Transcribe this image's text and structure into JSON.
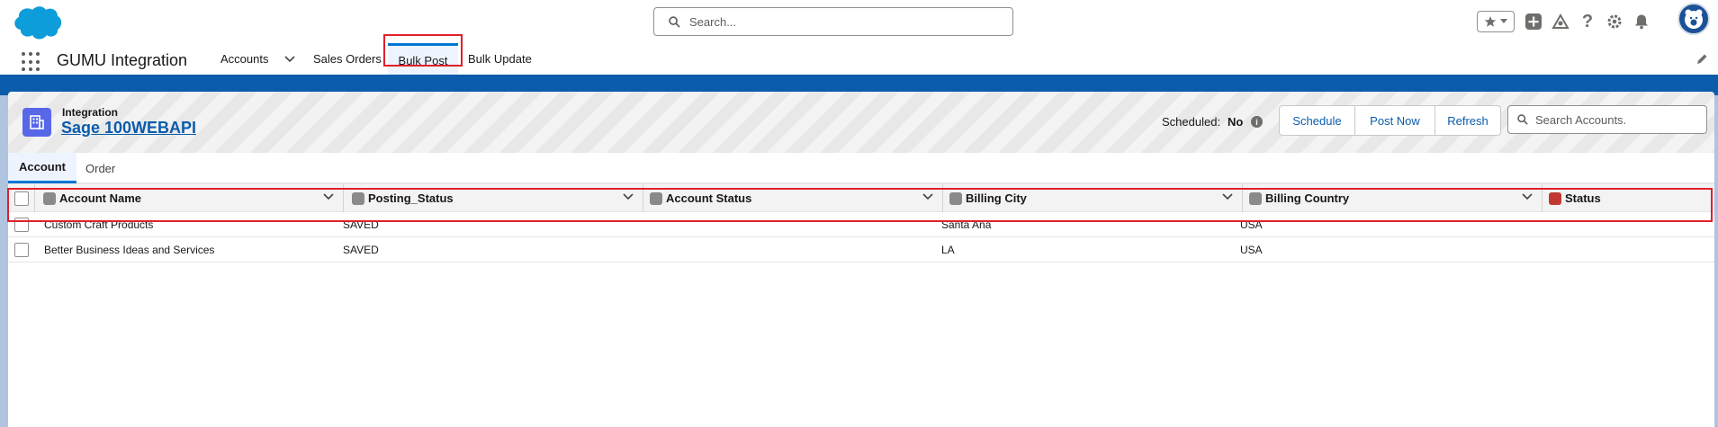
{
  "colors": {
    "brand": "#0176d3",
    "nav_accent": "#0b5cab",
    "highlight": "#e0202a",
    "object_icon": "#5867e8"
  },
  "global_search": {
    "placeholder": "Search..."
  },
  "header_icons": [
    "star-icon",
    "add-icon",
    "trailhead-icon",
    "help-icon",
    "setup-gear-icon",
    "bell-icon",
    "avatar"
  ],
  "app": {
    "name": "GUMU Integration"
  },
  "nav": {
    "items": [
      {
        "label": "Accounts",
        "has_dropdown": true
      },
      {
        "label": "Sales Orders"
      },
      {
        "label": "Bulk Post",
        "active": true
      },
      {
        "label": "Bulk Update"
      }
    ]
  },
  "card": {
    "object_label": "Integration",
    "title": "Sage 100WEBAPI",
    "scheduled_label": "Scheduled:",
    "scheduled_value": "No",
    "buttons": {
      "schedule": "Schedule",
      "post_now": "Post Now",
      "refresh": "Refresh"
    },
    "search_placeholder": "Search Accounts."
  },
  "tabs": [
    {
      "label": "Account",
      "active": true
    },
    {
      "label": "Order"
    }
  ],
  "table": {
    "columns": [
      "Account Name",
      "Posting_Status",
      "Account Status",
      "Billing City",
      "Billing Country",
      "Status"
    ],
    "rows": [
      {
        "account_name": "Custom Craft Products",
        "posting_status": "SAVED",
        "account_status": "",
        "billing_city": "Santa Ana",
        "billing_country": "USA",
        "status": ""
      },
      {
        "account_name": "Better Business Ideas and Services",
        "posting_status": "SAVED",
        "account_status": "",
        "billing_city": "LA",
        "billing_country": "USA",
        "status": ""
      }
    ]
  }
}
